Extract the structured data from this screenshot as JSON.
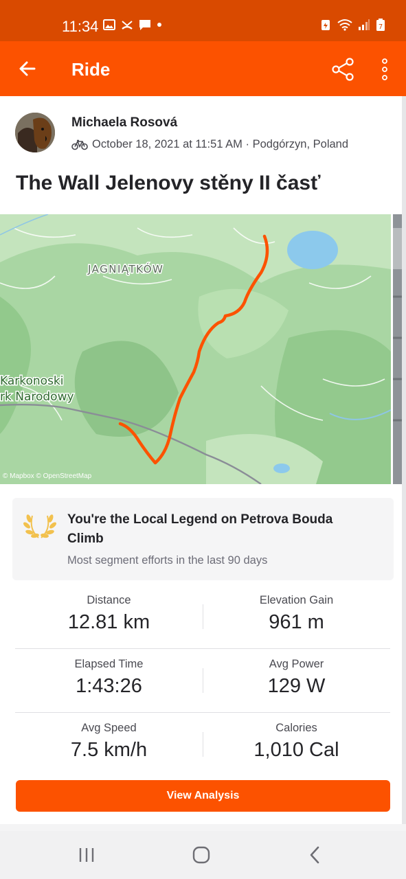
{
  "status_bar": {
    "time": "11:34",
    "left_icons": [
      "image-icon",
      "missed-call-icon",
      "message-icon",
      "dot-icon"
    ],
    "right_icons": [
      "battery-saver-icon",
      "wifi-icon",
      "signal-icon",
      "battery-icon"
    ]
  },
  "app_bar": {
    "title": "Ride",
    "back_icon": "arrow-left-icon",
    "share_icon": "share-icon",
    "more_icon": "more-vertical-icon"
  },
  "activity": {
    "athlete_name": "Michaela Rosová",
    "sport_icon": "bike-icon",
    "date_location": "October 18, 2021 at 11:51 AM · Podgórzyn, Poland",
    "title": "The Wall Jelenovy stěny II časť"
  },
  "map": {
    "labels": {
      "village": "JAGNIĄTKÓW",
      "park_line1": "Karkonoski",
      "park_line2": "rk Narodowy"
    },
    "attribution": "© Mapbox © OpenStreetMap",
    "route_color": "#fc5200"
  },
  "local_legend": {
    "icon": "laurel-icon",
    "title": "You're the Local Legend on Petrova Bouda Climb",
    "subtitle": "Most segment efforts in the last 90 days"
  },
  "stats": [
    {
      "left": {
        "label": "Distance",
        "value": "12.81 km"
      },
      "right": {
        "label": "Elevation Gain",
        "value": "961 m"
      }
    },
    {
      "left": {
        "label": "Elapsed Time",
        "value": "1:43:26"
      },
      "right": {
        "label": "Avg Power",
        "value": "129 W"
      }
    },
    {
      "left": {
        "label": "Avg Speed",
        "value": "7.5 km/h"
      },
      "right": {
        "label": "Calories",
        "value": "1,010 Cal"
      }
    }
  ],
  "view_analysis_label": "View Analysis",
  "nav_bar": {
    "recents_icon": "recents-icon",
    "home_icon": "home-icon",
    "back_icon": "nav-back-icon"
  },
  "colors": {
    "brand": "#fc5200",
    "status_bar": "#d94a00",
    "legend_gold": "#f2c14e"
  }
}
